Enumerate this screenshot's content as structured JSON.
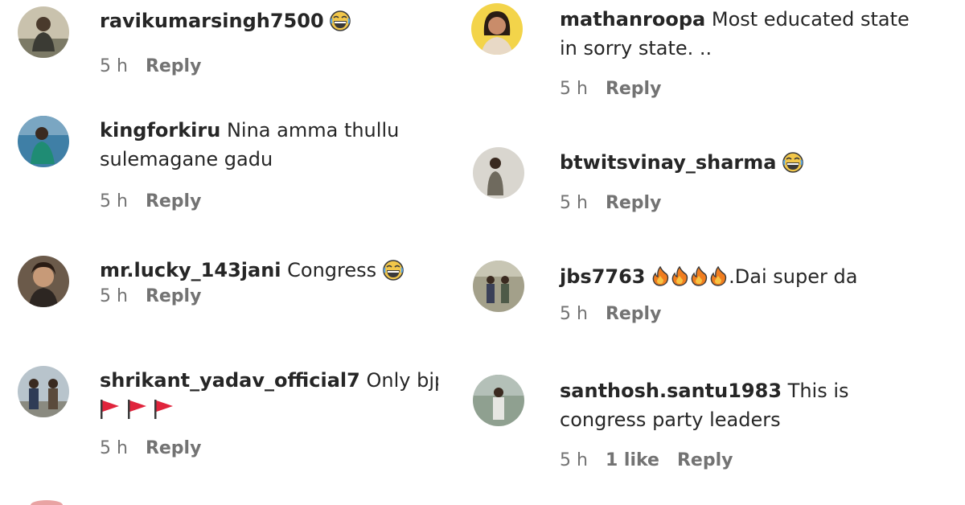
{
  "comments_left": [
    {
      "username": "ravikumarsingh7500",
      "text": "",
      "emoji": "laugh",
      "time": "5 h",
      "reply": "Reply"
    },
    {
      "username": "kingforkiru",
      "text": "Nina amma thullu",
      "text2": "sulemagane gadu",
      "time": "5 h",
      "reply": "Reply"
    },
    {
      "username": "mr.lucky_143jani",
      "text": "Congress",
      "emoji": "laugh",
      "time": "5 h",
      "reply": "Reply"
    },
    {
      "username": "shrikant_yadav_official7",
      "text": "Only bjp",
      "emoji2": "flags",
      "time": "5 h",
      "reply": "Reply"
    }
  ],
  "comments_right": [
    {
      "username": "mathanroopa",
      "text": "Most educated state",
      "text2": "in sorry state. ..",
      "time": "5 h",
      "reply": "Reply"
    },
    {
      "username": "btwitsvinay_sharma",
      "text": "",
      "emoji": "laugh",
      "time": "5 h",
      "reply": "Reply"
    },
    {
      "username": "jbs7763",
      "text": ".Dai super da",
      "emoji": "fire x4",
      "time": "5 h",
      "reply": "Reply"
    },
    {
      "username": "santhosh.santu1983",
      "text": "This is",
      "text2": "congress party leaders",
      "time": "5 h",
      "likes": "1 like",
      "reply": "Reply"
    }
  ],
  "colors": {
    "text": "#262626",
    "meta": "#737373",
    "background": "#ffffff"
  }
}
